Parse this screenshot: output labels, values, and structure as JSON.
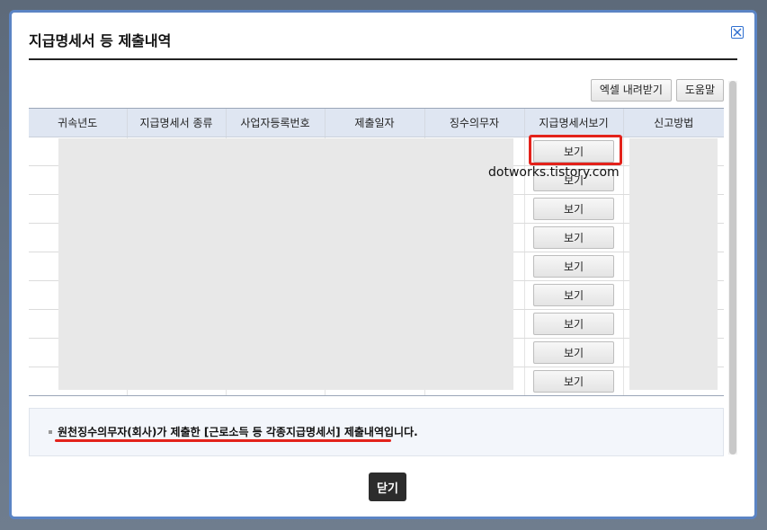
{
  "dialog": {
    "title": "지급명세서 등 제출내역",
    "close_icon": "close-x-icon"
  },
  "toolbar": {
    "excel_label": "엑셀 내려받기",
    "help_label": "도움말"
  },
  "table": {
    "headers": [
      "귀속년도",
      "지급명세서 종류",
      "사업자등록번호",
      "제출일자",
      "징수의무자",
      "지급명세서보기",
      "신고방법"
    ],
    "view_label": "보기",
    "row_count": 9
  },
  "watermark": "dotworks.tistory.com",
  "notice": {
    "text": "원천징수의무자(회사)가 제출한 [근로소득 등 각종지급명세서] 제출내역입니다."
  },
  "footer": {
    "close_label": "닫기"
  },
  "colors": {
    "modal_border": "#5b84c4",
    "header_bg": "#dfe6f2",
    "highlight": "#e3221b",
    "redaction": "#e8e8e8"
  }
}
